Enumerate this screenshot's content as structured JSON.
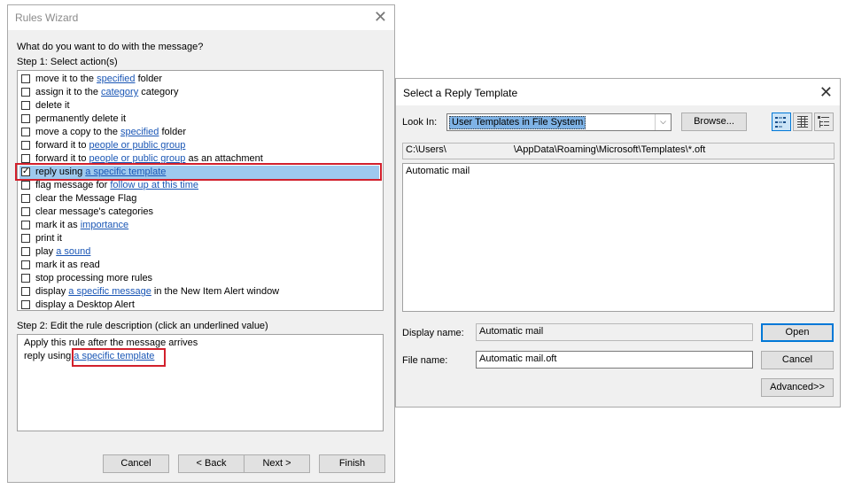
{
  "rules_wizard": {
    "title": "Rules Wizard",
    "close_glyph": "✕",
    "question": "What do you want to do with the message?",
    "step1_label": "Step 1: Select action(s)",
    "actions": [
      {
        "pre": "move it to the ",
        "link": "specified",
        "post": " folder",
        "checked": false
      },
      {
        "pre": "assign it to the ",
        "link": "category",
        "post": " category",
        "checked": false
      },
      {
        "pre": "delete it",
        "link": "",
        "post": "",
        "checked": false
      },
      {
        "pre": "permanently delete it",
        "link": "",
        "post": "",
        "checked": false
      },
      {
        "pre": "move a copy to the ",
        "link": "specified",
        "post": " folder",
        "checked": false
      },
      {
        "pre": "forward it to ",
        "link": "people or public group",
        "post": "",
        "checked": false
      },
      {
        "pre": "forward it to ",
        "link": "people or public group",
        "post": " as an attachment",
        "checked": false
      },
      {
        "pre": "reply using ",
        "link": "a specific template",
        "post": "",
        "checked": true
      },
      {
        "pre": "flag message for ",
        "link": "follow up at this time",
        "post": "",
        "checked": false
      },
      {
        "pre": "clear the Message Flag",
        "link": "",
        "post": "",
        "checked": false
      },
      {
        "pre": "clear message's categories",
        "link": "",
        "post": "",
        "checked": false
      },
      {
        "pre": "mark it as ",
        "link": "importance",
        "post": "",
        "checked": false
      },
      {
        "pre": "print it",
        "link": "",
        "post": "",
        "checked": false
      },
      {
        "pre": "play ",
        "link": "a sound",
        "post": "",
        "checked": false
      },
      {
        "pre": "mark it as read",
        "link": "",
        "post": "",
        "checked": false
      },
      {
        "pre": "stop processing more rules",
        "link": "",
        "post": "",
        "checked": false
      },
      {
        "pre": "display ",
        "link": "a specific message",
        "post": " in the New Item Alert window",
        "checked": false
      },
      {
        "pre": "display a Desktop Alert",
        "link": "",
        "post": "",
        "checked": false
      }
    ],
    "step2_label": "Step 2: Edit the rule description (click an underlined value)",
    "desc_line1": "Apply this rule after the message arrives",
    "desc_line2_pre": "reply using ",
    "desc_line2_link": "a specific template",
    "buttons": {
      "cancel": "Cancel",
      "back": "< Back",
      "next": "Next >",
      "finish": "Finish"
    }
  },
  "reply_template": {
    "title": "Select a Reply Template",
    "close_glyph": "✕",
    "look_in_label": "Look In:",
    "look_in_value": "User Templates in File System",
    "browse_label": "Browse...",
    "path_prefix": "C:\\Users\\",
    "path_suffix": "\\AppData\\Roaming\\Microsoft\\Templates\\*.oft",
    "files": [
      "Automatic mail"
    ],
    "display_name_label": "Display name:",
    "display_name_value": "Automatic mail",
    "file_name_label": "File name:",
    "file_name_value": "Automatic mail.oft",
    "open_label": "Open",
    "cancel_label": "Cancel",
    "advanced_label": "Advanced>>"
  },
  "colors": {
    "highlight_red": "#d2202c",
    "selection_blue": "#9ec9ee",
    "link_blue": "#1a56b5"
  }
}
